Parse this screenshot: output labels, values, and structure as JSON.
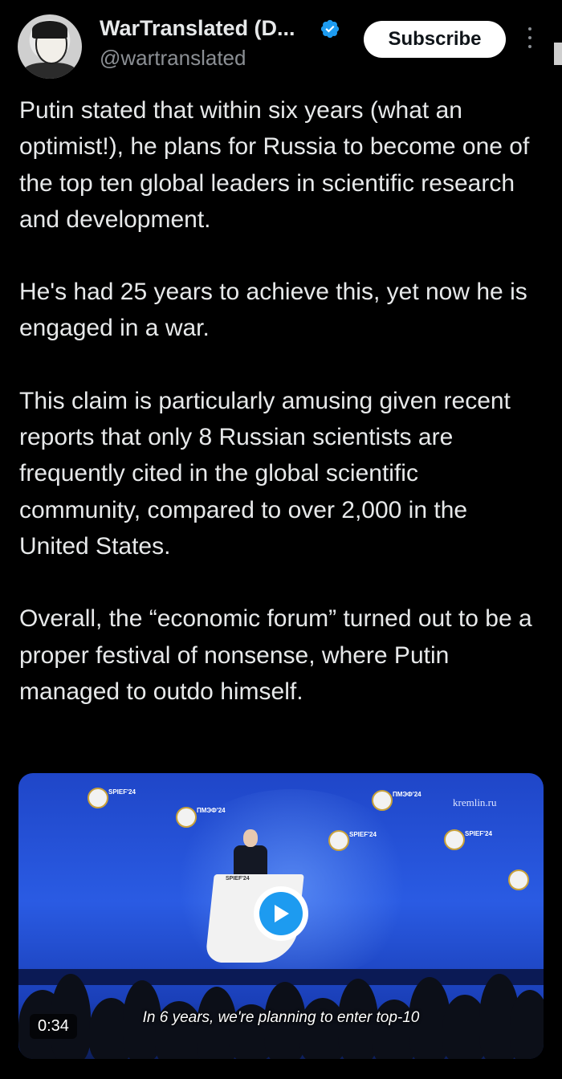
{
  "author": {
    "name": "WarTranslated (D...",
    "handle": "@wartranslated",
    "verified": true
  },
  "header": {
    "subscribe_label": "Subscribe",
    "more_icon": "vertical-ellipsis-icon"
  },
  "post": {
    "paragraphs": [
      "Putin stated that within six years (what an optimist!), he plans for Russia to become one of the top ten global leaders in scientific research and development.",
      "He's had 25 years to achieve this, yet now he is engaged in a war.",
      "This claim is particularly amusing given recent reports that only 8 Russian scientists are frequently cited in the global scientific community, compared to over 2,000 in the United States.",
      "Overall, the “economic forum” turned out to be a proper festival of nonsense, where Putin managed to outdo himself."
    ]
  },
  "video": {
    "caption": "In 6 years, we're planning to enter top-10",
    "duration": "0:34",
    "watermark": "kremlin.ru",
    "logo_texts": [
      "SPIEF'24",
      "ПМЭФ'24",
      "SPIEF'24",
      "ПМЭФ'24",
      "SPIEF'24",
      "SPIEF'24"
    ]
  },
  "colors": {
    "background": "#000000",
    "text": "#e7e9ea",
    "muted": "#8b8f94",
    "accent": "#1d9bf0",
    "video_blue": "#2a5be3"
  }
}
